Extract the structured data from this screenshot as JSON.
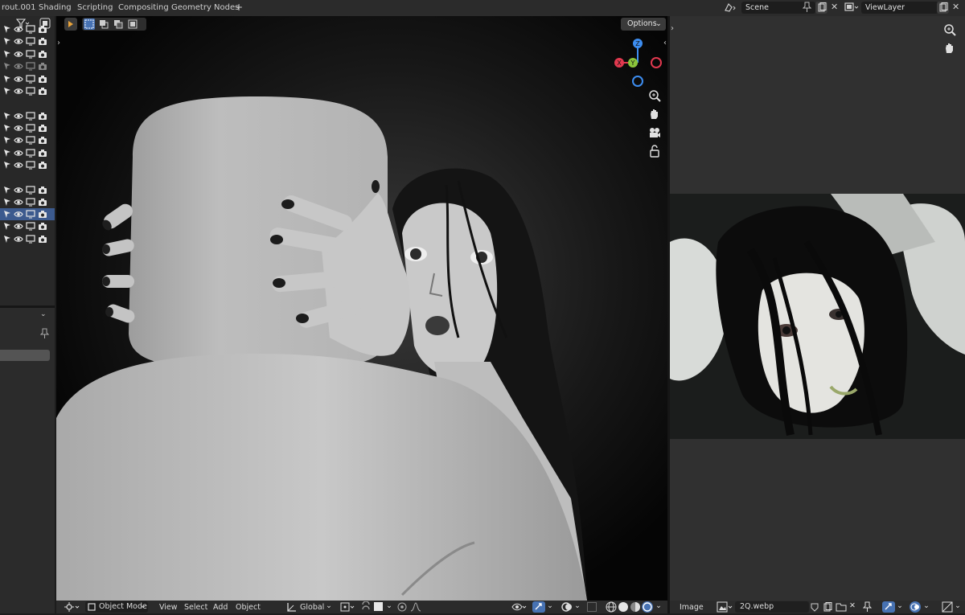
{
  "topbar": {
    "tabs": [
      "rout.001",
      "Shading",
      "Scripting",
      "Compositing",
      "Geometry Nodes"
    ],
    "add_tab": "+",
    "scene": "Scene",
    "view_layer": "ViewLayer"
  },
  "viewport": {
    "options_label": "Options",
    "gizmo": {
      "z": "Z",
      "y": "Y",
      "x": "X"
    }
  },
  "bottombar": {
    "mode": "Object Mode",
    "menus": [
      "View",
      "Select",
      "Add",
      "Object"
    ],
    "transform_orientation": "Global"
  },
  "image_editor": {
    "menu": "Image",
    "image_name": "2Q.webp"
  },
  "outliner": {
    "selected_row": 13
  },
  "colors": {
    "axis_x": "#e2394f",
    "axis_y": "#8ac43b",
    "axis_z": "#3d8df0",
    "selection": "#3c5a8e"
  }
}
